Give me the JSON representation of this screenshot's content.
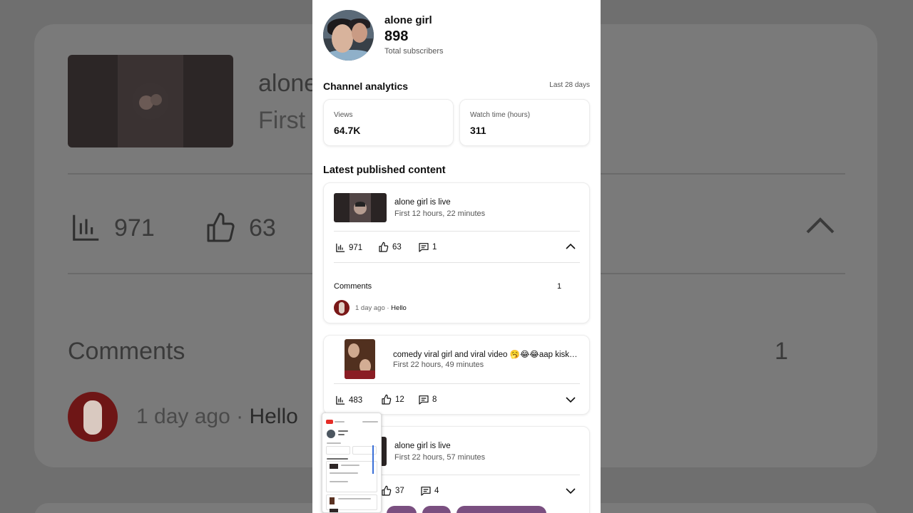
{
  "channel": {
    "name": "alone girl",
    "subscribers": "898",
    "subscribers_label": "Total subscribers"
  },
  "analytics": {
    "title": "Channel analytics",
    "period": "Last 28 days",
    "views_label": "Views",
    "views_value": "64.7K",
    "watch_label": "Watch time (hours)",
    "watch_value": "311"
  },
  "latest": {
    "title": "Latest published content",
    "items": [
      {
        "title": "alone girl  is live",
        "subtitle": "First 12 hours, 22 minutes",
        "views": "971",
        "likes": "63",
        "comments": "1",
        "expanded": true,
        "comments_label": "Comments",
        "comments_count": "1",
        "comment_meta": "1 day ago · ",
        "comment_text": "Hello"
      },
      {
        "title": "comedy viral girl and viral video 🥱😂😂aap kiske...",
        "subtitle": "First 22 hours, 49 minutes",
        "views": "483",
        "likes": "12",
        "comments": "8",
        "expanded": false
      },
      {
        "title": "alone girl  is live",
        "subtitle": "First 22 hours, 57 minutes",
        "likes": "37",
        "comments": "4",
        "expanded": false
      }
    ]
  },
  "background": {
    "title": "alone",
    "subtitle": "First",
    "views": "971",
    "likes": "63",
    "comments_label": "Comments",
    "comments_count": "1",
    "comment_meta": "1 day ago · ",
    "comment_text": "Hello"
  },
  "icons": {
    "views": "bar-chart-icon",
    "likes": "thumbs-up-icon",
    "comments": "comment-icon",
    "expand": "chevron-down-icon",
    "collapse": "chevron-up-icon"
  },
  "colors": {
    "background_dim": "#6f6f6f",
    "panel": "#ffffff",
    "text": "#0f0f0f",
    "secondary_text": "#555555",
    "pill": "#7a4f80"
  }
}
